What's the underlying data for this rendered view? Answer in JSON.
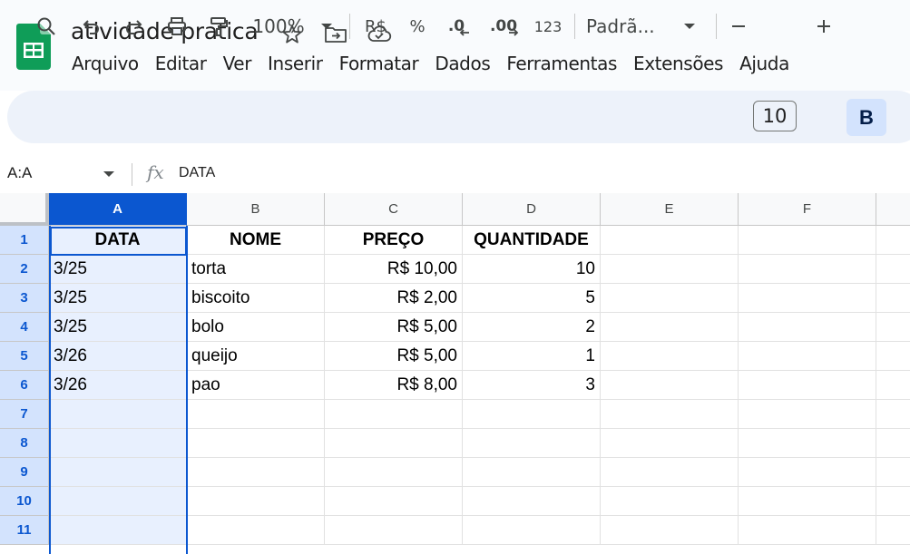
{
  "app": {
    "doc_title": "atividade pratica",
    "brand_color": "#0f9d58"
  },
  "menu": [
    "Arquivo",
    "Editar",
    "Ver",
    "Inserir",
    "Formatar",
    "Dados",
    "Ferramentas",
    "Extensões",
    "Ajuda"
  ],
  "toolbar": {
    "zoom": "100%",
    "currency": "R$",
    "percent": "%",
    "decrease_decimal": ".0",
    "increase_decimal": ".00",
    "number_format": "123",
    "font": "Padrã...",
    "font_size": "10",
    "bold": "B"
  },
  "formula_bar": {
    "name_box": "A:A",
    "fx": "fx",
    "content": "DATA"
  },
  "columns": [
    "A",
    "B",
    "C",
    "D",
    "E",
    "F"
  ],
  "rows": [
    "1",
    "2",
    "3",
    "4",
    "5",
    "6",
    "7",
    "8",
    "9",
    "10",
    "11"
  ],
  "cells": [
    [
      "DATA",
      "NOME",
      "PREÇO",
      "QUANTIDADE",
      "",
      ""
    ],
    [
      "3/25",
      "torta",
      "R$ 10,00",
      "10",
      "",
      ""
    ],
    [
      "3/25",
      "biscoito",
      "R$ 2,00",
      "5",
      "",
      ""
    ],
    [
      "3/25",
      "bolo",
      "R$ 5,00",
      "2",
      "",
      ""
    ],
    [
      "3/26",
      "queijo",
      "R$ 5,00",
      "1",
      "",
      ""
    ],
    [
      "3/26",
      "pao",
      "R$ 8,00",
      "3",
      "",
      ""
    ],
    [
      "",
      "",
      "",
      "",
      "",
      ""
    ],
    [
      "",
      "",
      "",
      "",
      "",
      ""
    ],
    [
      "",
      "",
      "",
      "",
      "",
      ""
    ],
    [
      "",
      "",
      "",
      "",
      "",
      ""
    ],
    [
      "",
      "",
      "",
      "",
      "",
      ""
    ]
  ],
  "selection": {
    "selected_column": "A",
    "accent": "#0b57d0"
  }
}
